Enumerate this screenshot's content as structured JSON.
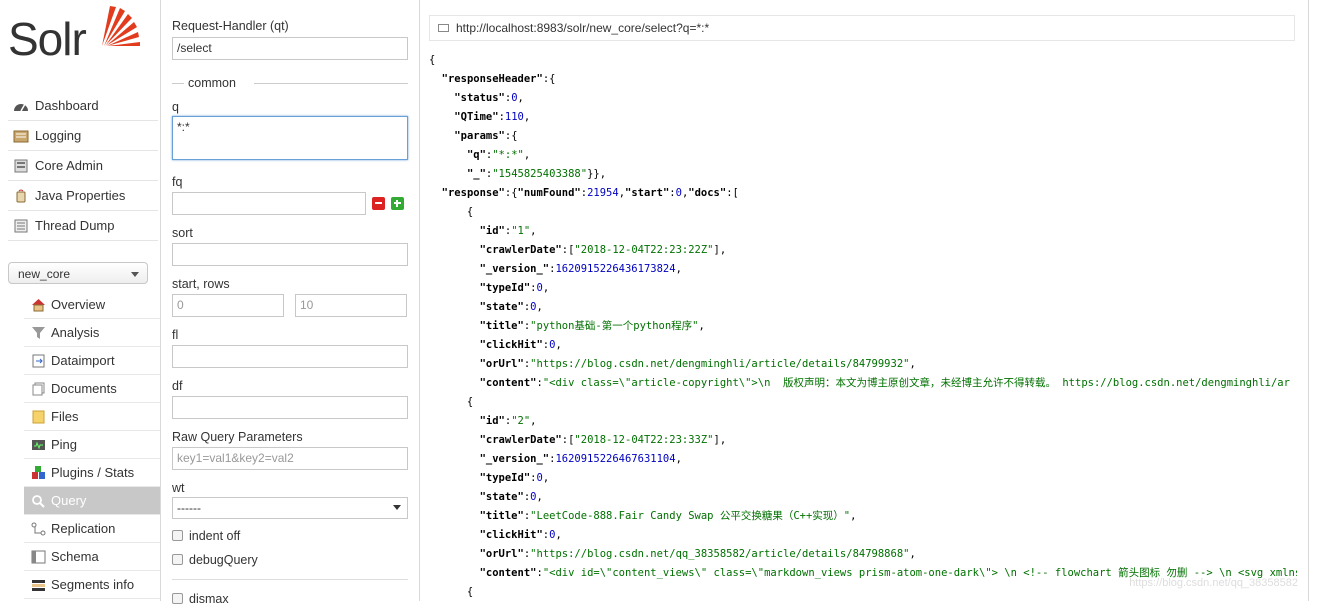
{
  "logo": {
    "text": "Solr"
  },
  "main_menu": [
    {
      "label": "Dashboard",
      "icon": "dashboard-icon"
    },
    {
      "label": "Logging",
      "icon": "logging-icon"
    },
    {
      "label": "Core Admin",
      "icon": "core-admin-icon"
    },
    {
      "label": "Java Properties",
      "icon": "java-icon"
    },
    {
      "label": "Thread Dump",
      "icon": "thread-dump-icon"
    }
  ],
  "core_selector": {
    "value": "new_core"
  },
  "core_menu": [
    {
      "label": "Overview",
      "icon": "home-icon"
    },
    {
      "label": "Analysis",
      "icon": "funnel-icon"
    },
    {
      "label": "Dataimport",
      "icon": "dataimport-icon"
    },
    {
      "label": "Documents",
      "icon": "documents-icon"
    },
    {
      "label": "Files",
      "icon": "folder-icon"
    },
    {
      "label": "Ping",
      "icon": "ping-icon"
    },
    {
      "label": "Plugins / Stats",
      "icon": "plugins-icon"
    },
    {
      "label": "Query",
      "icon": "magnifier-icon",
      "active": true
    },
    {
      "label": "Replication",
      "icon": "replication-icon"
    },
    {
      "label": "Schema",
      "icon": "schema-icon"
    },
    {
      "label": "Segments info",
      "icon": "segments-icon"
    }
  ],
  "form": {
    "request_handler_label": "Request-Handler (qt)",
    "request_handler_value": "/select",
    "common_legend": "common",
    "q_label": "q",
    "q_value": "*:*",
    "fq_label": "fq",
    "sort_label": "sort",
    "start_rows_label": "start, rows",
    "start_placeholder": "0",
    "rows_placeholder": "10",
    "fl_label": "fl",
    "df_label": "df",
    "raw_label": "Raw Query Parameters",
    "raw_placeholder": "key1=val1&key2=val2",
    "wt_label": "wt",
    "wt_value": "------",
    "indent_label": "indent off",
    "debug_label": "debugQuery",
    "dismax_label": "dismax"
  },
  "response": {
    "url": "http://localhost:8983/solr/new_core/select?q=*:*",
    "lines": [
      [
        [
          "p",
          "{"
        ]
      ],
      [
        [
          "p",
          "  "
        ],
        [
          "k",
          "\"responseHeader\""
        ],
        [
          "p",
          ":{"
        ]
      ],
      [
        [
          "p",
          "    "
        ],
        [
          "k",
          "\"status\""
        ],
        [
          "p",
          ":"
        ],
        [
          "n",
          "0"
        ],
        [
          "p",
          ","
        ]
      ],
      [
        [
          "p",
          "    "
        ],
        [
          "k",
          "\"QTime\""
        ],
        [
          "p",
          ":"
        ],
        [
          "n",
          "110"
        ],
        [
          "p",
          ","
        ]
      ],
      [
        [
          "p",
          "    "
        ],
        [
          "k",
          "\"params\""
        ],
        [
          "p",
          ":{"
        ]
      ],
      [
        [
          "p",
          "      "
        ],
        [
          "k",
          "\"q\""
        ],
        [
          "p",
          ":"
        ],
        [
          "s",
          "\"*:*\""
        ],
        [
          "p",
          ","
        ]
      ],
      [
        [
          "p",
          "      "
        ],
        [
          "k",
          "\"_\""
        ],
        [
          "p",
          ":"
        ],
        [
          "s",
          "\"1545825403388\""
        ],
        [
          "p",
          "}},"
        ]
      ],
      [
        [
          "p",
          "  "
        ],
        [
          "k",
          "\"response\""
        ],
        [
          "p",
          ":{"
        ],
        [
          "k",
          "\"numFound\""
        ],
        [
          "p",
          ":"
        ],
        [
          "n",
          "21954"
        ],
        [
          "p",
          ","
        ],
        [
          "k",
          "\"start\""
        ],
        [
          "p",
          ":"
        ],
        [
          "n",
          "0"
        ],
        [
          "p",
          ","
        ],
        [
          "k",
          "\"docs\""
        ],
        [
          "p",
          ":["
        ]
      ],
      [
        [
          "p",
          "      {"
        ]
      ],
      [
        [
          "p",
          "        "
        ],
        [
          "k",
          "\"id\""
        ],
        [
          "p",
          ":"
        ],
        [
          "s",
          "\"1\""
        ],
        [
          "p",
          ","
        ]
      ],
      [
        [
          "p",
          "        "
        ],
        [
          "k",
          "\"crawlerDate\""
        ],
        [
          "p",
          ":["
        ],
        [
          "s",
          "\"2018-12-04T22:23:22Z\""
        ],
        [
          "p",
          "],"
        ]
      ],
      [
        [
          "p",
          "        "
        ],
        [
          "k",
          "\"_version_\""
        ],
        [
          "p",
          ":"
        ],
        [
          "n",
          "1620915226436173824"
        ],
        [
          "p",
          ","
        ]
      ],
      [
        [
          "p",
          "        "
        ],
        [
          "k",
          "\"typeId\""
        ],
        [
          "p",
          ":"
        ],
        [
          "n",
          "0"
        ],
        [
          "p",
          ","
        ]
      ],
      [
        [
          "p",
          "        "
        ],
        [
          "k",
          "\"state\""
        ],
        [
          "p",
          ":"
        ],
        [
          "n",
          "0"
        ],
        [
          "p",
          ","
        ]
      ],
      [
        [
          "p",
          "        "
        ],
        [
          "k",
          "\"title\""
        ],
        [
          "p",
          ":"
        ],
        [
          "s",
          "\"python基础-第一个python程序\""
        ],
        [
          "p",
          ","
        ]
      ],
      [
        [
          "p",
          "        "
        ],
        [
          "k",
          "\"clickHit\""
        ],
        [
          "p",
          ":"
        ],
        [
          "n",
          "0"
        ],
        [
          "p",
          ","
        ]
      ],
      [
        [
          "p",
          "        "
        ],
        [
          "k",
          "\"orUrl\""
        ],
        [
          "p",
          ":"
        ],
        [
          "s",
          "\"https://blog.csdn.net/dengminghli/article/details/84799932\""
        ],
        [
          "p",
          ","
        ]
      ],
      [
        [
          "p",
          "        "
        ],
        [
          "k",
          "\"content\""
        ],
        [
          "p",
          ":"
        ],
        [
          "s",
          "\"<div class=\\\"article-copyright\\\">\\n  版权声明：本文为博主原创文章，未经博主允许不得转载。 https://blog.csdn.net/dengminghli/ar"
        ]
      ],
      [
        [
          "p",
          "      {"
        ]
      ],
      [
        [
          "p",
          "        "
        ],
        [
          "k",
          "\"id\""
        ],
        [
          "p",
          ":"
        ],
        [
          "s",
          "\"2\""
        ],
        [
          "p",
          ","
        ]
      ],
      [
        [
          "p",
          "        "
        ],
        [
          "k",
          "\"crawlerDate\""
        ],
        [
          "p",
          ":["
        ],
        [
          "s",
          "\"2018-12-04T22:23:33Z\""
        ],
        [
          "p",
          "],"
        ]
      ],
      [
        [
          "p",
          "        "
        ],
        [
          "k",
          "\"_version_\""
        ],
        [
          "p",
          ":"
        ],
        [
          "n",
          "1620915226467631104"
        ],
        [
          "p",
          ","
        ]
      ],
      [
        [
          "p",
          "        "
        ],
        [
          "k",
          "\"typeId\""
        ],
        [
          "p",
          ":"
        ],
        [
          "n",
          "0"
        ],
        [
          "p",
          ","
        ]
      ],
      [
        [
          "p",
          "        "
        ],
        [
          "k",
          "\"state\""
        ],
        [
          "p",
          ":"
        ],
        [
          "n",
          "0"
        ],
        [
          "p",
          ","
        ]
      ],
      [
        [
          "p",
          "        "
        ],
        [
          "k",
          "\"title\""
        ],
        [
          "p",
          ":"
        ],
        [
          "s",
          "\"LeetCode-888.Fair Candy Swap 公平交换糖果（C++实现）\""
        ],
        [
          "p",
          ","
        ]
      ],
      [
        [
          "p",
          "        "
        ],
        [
          "k",
          "\"clickHit\""
        ],
        [
          "p",
          ":"
        ],
        [
          "n",
          "0"
        ],
        [
          "p",
          ","
        ]
      ],
      [
        [
          "p",
          "        "
        ],
        [
          "k",
          "\"orUrl\""
        ],
        [
          "p",
          ":"
        ],
        [
          "s",
          "\"https://blog.csdn.net/qq_38358582/article/details/84798868\""
        ],
        [
          "p",
          ","
        ]
      ],
      [
        [
          "p",
          "        "
        ],
        [
          "k",
          "\"content\""
        ],
        [
          "p",
          ":"
        ],
        [
          "s",
          "\"<div id=\\\"content_views\\\" class=\\\"markdown_views prism-atom-one-dark\\\"> \\n <!-- flowchart 箭头图标 勿删 --> \\n <svg xmlns=\\\"h"
        ]
      ],
      [
        [
          "p",
          "      {"
        ]
      ]
    ]
  },
  "watermark": "https://blog.csdn.net/qq_38358582"
}
